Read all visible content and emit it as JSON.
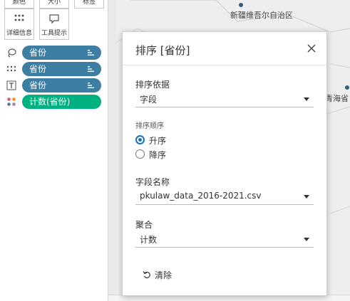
{
  "marks_panel": {
    "tiles": {
      "top_row": [
        "颜色",
        "大小",
        "标签"
      ],
      "detail": "详细信息",
      "tooltip": "工具提示"
    },
    "shelf": [
      {
        "icon": "lasso-icon",
        "label": "省份",
        "color": "#3d7fa2"
      },
      {
        "icon": "detail-dots-icon",
        "label": "省份",
        "color": "#3d7fa2"
      },
      {
        "icon": "text-t-icon",
        "label": "省份",
        "color": "#3d7fa2"
      },
      {
        "icon": "color-dots-icon",
        "label": "计数(省份)",
        "color": "#00b180"
      }
    ]
  },
  "map": {
    "labels": {
      "xinjiang": "新疆维吾尔自治区",
      "qinghai": "青海省"
    }
  },
  "dialog": {
    "title": "排序 [省份]",
    "sort_by": {
      "label": "排序依据",
      "value": "字段"
    },
    "sort_order": {
      "label": "排序顺序",
      "options": [
        {
          "label": "升序",
          "checked": true
        },
        {
          "label": "降序",
          "checked": false
        }
      ]
    },
    "field_name": {
      "label": "字段名称",
      "value": "pkulaw_data_2016-2021.csv"
    },
    "aggregation": {
      "label": "聚合",
      "value": "计数"
    },
    "clear_label": "清除"
  },
  "colors": {
    "pill_blue": "#3d7fa2",
    "pill_green": "#00b180",
    "radio_accent": "#1d73b8"
  }
}
